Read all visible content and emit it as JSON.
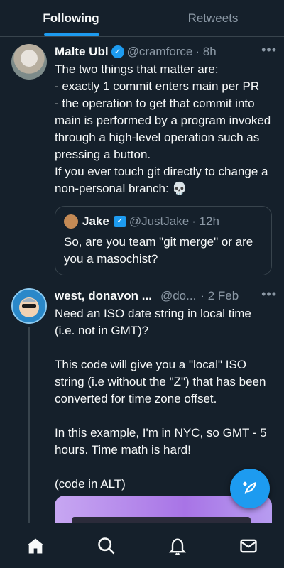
{
  "tabs": [
    {
      "label": "Following",
      "active": true
    },
    {
      "label": "Retweets",
      "active": false
    }
  ],
  "tweets": [
    {
      "name": "Malte Ubl",
      "handle": "@cramforce",
      "time": "· 8h",
      "verified": true,
      "text": "The two things that matter are:\n- exactly 1 commit enters main per PR\n- the operation to get that commit into main is performed by a program invoked through a high-level operation such as pressing a button.\nIf you ever touch git directly to change a non-personal branch: 💀",
      "quote": {
        "name": "Jake",
        "handle": "@JustJake",
        "time": "· 12h",
        "text": "So, are you team \"git merge\" or are you a masochist?"
      }
    },
    {
      "name": "west, donavon ...",
      "handle": "@do...",
      "time": "· 2 Feb",
      "text": "Need an ISO date string in local time (i.e. not in GMT)?\n\nThis code will give you a \"local\" ISO string (i.e without the \"Z\") that has been converted for time zone offset.\n\nIn this example, I'm in NYC, so GMT - 5 hours. Time math is hard!\n\n(code in ALT)"
    }
  ],
  "more_label": "•••",
  "colors": {
    "accent": "#1d9bf0",
    "background": "#15202b",
    "border": "#38444d",
    "secondary_text": "#8b98a5"
  },
  "nav": [
    "home-icon",
    "search-icon",
    "notifications-icon",
    "messages-icon"
  ]
}
